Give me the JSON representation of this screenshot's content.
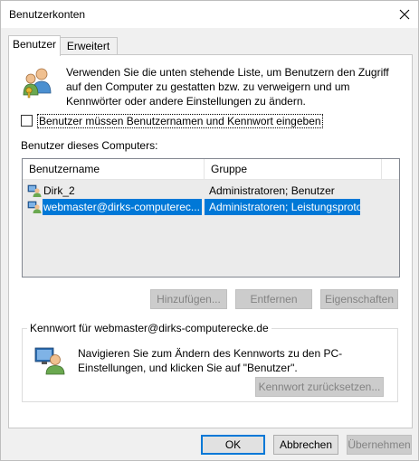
{
  "window": {
    "title": "Benutzerkonten",
    "close_icon": "close-icon"
  },
  "tabs": [
    {
      "label": "Benutzer",
      "active": true
    },
    {
      "label": "Erweitert",
      "active": false
    }
  ],
  "intro": {
    "icon": "users-keys-icon",
    "text": "Verwenden Sie die unten stehende Liste, um Benutzern den Zugriff auf den Computer zu gestatten bzw. zu verweigern und um Kennwörter oder andere Einstellungen zu ändern."
  },
  "checkbox": {
    "label": "Benutzer müssen Benutzernamen und Kennwort eingeben",
    "checked": false
  },
  "users": {
    "section_label": "Benutzer dieses Computers:",
    "columns": [
      "Benutzername",
      "Gruppe"
    ],
    "rows": [
      {
        "name": "Dirk_2",
        "group": "Administratoren; Benutzer",
        "selected": false
      },
      {
        "name": "webmaster@dirks-computerec...",
        "group": "Administratoren; Leistungsprotok...",
        "selected": true
      }
    ]
  },
  "list_buttons": {
    "add": "Hinzufügen...",
    "remove": "Entfernen",
    "properties": "Eigenschaften"
  },
  "password": {
    "group_title": "Kennwort für webmaster@dirks-computerecke.de",
    "icon": "user-monitor-icon",
    "text": "Navigieren Sie zum Ändern des Kennworts zu den PC-Einstellungen, und klicken Sie auf \"Benutzer\".",
    "reset_button": "Kennwort zurücksetzen..."
  },
  "dialog_buttons": {
    "ok": "OK",
    "cancel": "Abbrechen",
    "apply": "Übernehmen"
  },
  "colors": {
    "selection": "#0078d7",
    "default_button_border": "#0078d7"
  }
}
